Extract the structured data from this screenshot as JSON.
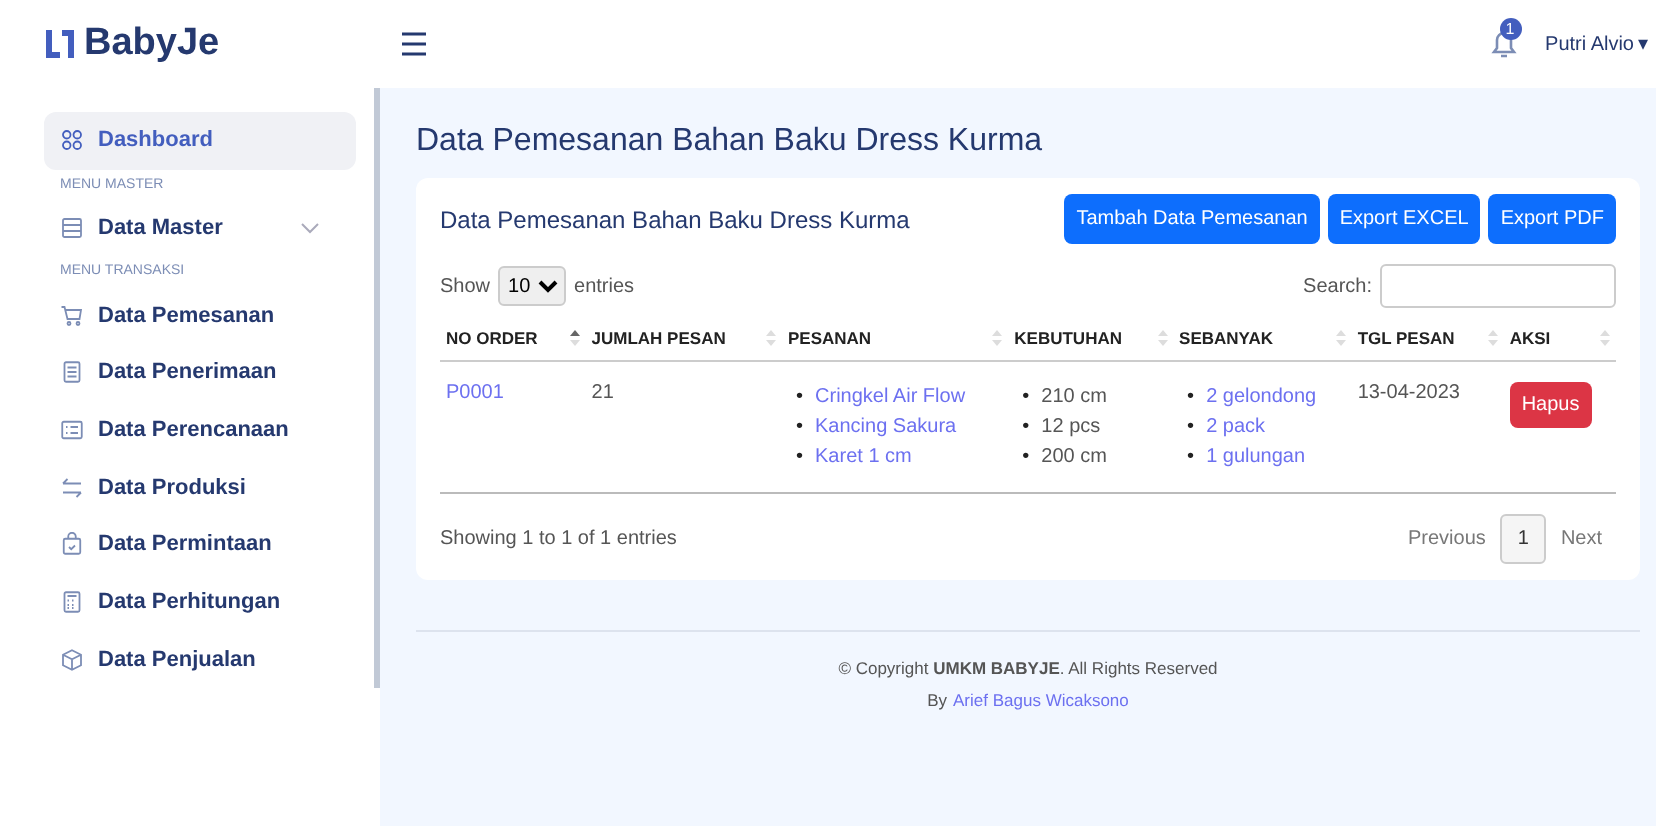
{
  "brand": "BabyJe",
  "header": {
    "notification_count": "1",
    "user": "Putri Alvio",
    "caret": "▾"
  },
  "sidebar": {
    "items": [
      {
        "kind": "item",
        "label": "Dashboard",
        "selected": true
      },
      {
        "kind": "section",
        "label": "MENU MASTER"
      },
      {
        "kind": "item",
        "label": "Data Master",
        "selected": false,
        "expandable": true
      },
      {
        "kind": "section",
        "label": "MENU TRANSAKSI"
      },
      {
        "kind": "item",
        "label": "Data Pemesanan",
        "selected": false
      },
      {
        "kind": "item",
        "label": "Data Penerimaan",
        "selected": false
      },
      {
        "kind": "item",
        "label": "Data Perencanaan",
        "selected": false
      },
      {
        "kind": "item",
        "label": "Data Produksi",
        "selected": false
      },
      {
        "kind": "item",
        "label": "Data Permintaan",
        "selected": false
      },
      {
        "kind": "item",
        "label": "Data Perhitungan",
        "selected": false
      },
      {
        "kind": "item",
        "label": "Data Penjualan",
        "selected": false
      }
    ]
  },
  "page_title": "Data Pemesanan Bahan Baku Dress Kurma",
  "card": {
    "title": "Data Pemesanan Bahan Baku Dress Kurma",
    "buttons": [
      "Tambah Data Pemesanan",
      "Export EXCEL",
      "Export PDF"
    ],
    "length": {
      "before": "Show",
      "value": "10",
      "after": "entries"
    },
    "search_label": "Search:",
    "table": {
      "columns": [
        {
          "label": "NO ORDER",
          "sorted": true
        },
        {
          "label": "JUMLAH PESAN",
          "sorted": false
        },
        {
          "label": "PESANAN",
          "sorted": false
        },
        {
          "label": "KEBUTUHAN",
          "sorted": false
        },
        {
          "label": "SEBANYAK",
          "sorted": false
        },
        {
          "label": "TGL PESAN",
          "sorted": false
        },
        {
          "label": "AKSI",
          "sorted": false
        }
      ],
      "bullet": "•",
      "rows": [
        {
          "no_order": "P0001",
          "jumlah_pesan": "21",
          "pesanan": [
            "Cringkel Air Flow",
            "Kancing Sakura",
            "Karet 1 cm"
          ],
          "kebutuhan": [
            "210 cm",
            "12 pcs",
            "200 cm"
          ],
          "sebanyak": [
            "2 gelondong",
            "2 pack",
            "1 gulungan"
          ],
          "tgl_pesan": "13-04-2023",
          "action": "Hapus"
        }
      ]
    },
    "info": "Showing 1 to 1 of 1 entries",
    "pagination": [
      {
        "label": "Previous",
        "kind": "nav",
        "selected": false
      },
      {
        "label": "1",
        "kind": "page",
        "selected": true
      },
      {
        "label": "Next",
        "kind": "nav",
        "selected": false
      }
    ]
  },
  "footer": {
    "copyright": "© Copyright **UMKM BABYJE**. All Rights Reserved",
    "by": "By",
    "author": "Arief Bagus Wicaksono"
  }
}
